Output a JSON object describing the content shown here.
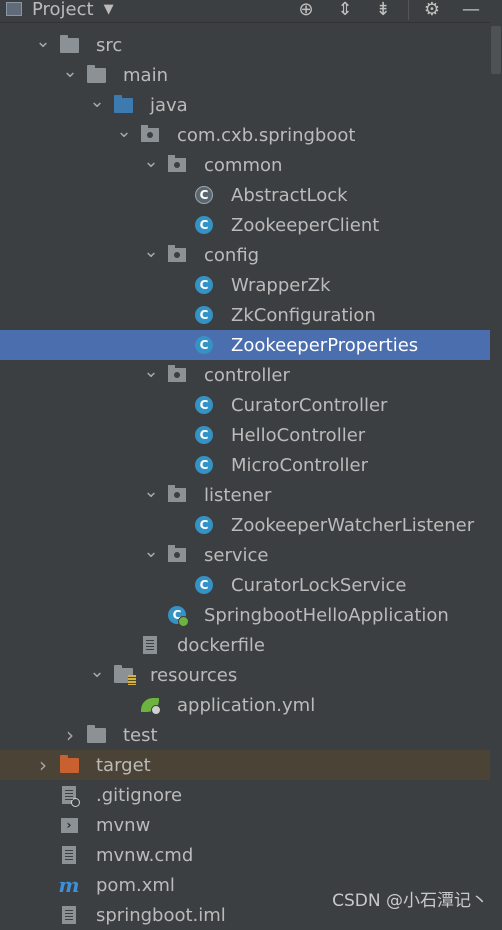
{
  "header": {
    "title": "Project",
    "icons": [
      "locate-icon",
      "expand-all-icon",
      "collapse-all-icon",
      "gear-icon",
      "minimize-icon"
    ]
  },
  "tree": [
    {
      "label": "src",
      "icon": "folder-icon",
      "arrow": "down"
    },
    {
      "label": "main",
      "icon": "folder-icon",
      "arrow": "down"
    },
    {
      "label": "java",
      "icon": "source-folder-icon",
      "arrow": "down"
    },
    {
      "label": "com.cxb.springboot",
      "icon": "package-icon",
      "arrow": "down"
    },
    {
      "label": "common",
      "icon": "package-icon",
      "arrow": "down"
    },
    {
      "label": "AbstractLock",
      "icon": "abstract-class-icon"
    },
    {
      "label": "ZookeeperClient",
      "icon": "class-icon"
    },
    {
      "label": "config",
      "icon": "package-icon",
      "arrow": "down"
    },
    {
      "label": "WrapperZk",
      "icon": "class-icon"
    },
    {
      "label": "ZkConfiguration",
      "icon": "class-icon"
    },
    {
      "label": "ZookeeperProperties",
      "icon": "class-icon",
      "selected": true
    },
    {
      "label": "controller",
      "icon": "package-icon",
      "arrow": "down"
    },
    {
      "label": "CuratorController",
      "icon": "class-icon"
    },
    {
      "label": "HelloController",
      "icon": "class-icon"
    },
    {
      "label": "MicroController",
      "icon": "class-icon"
    },
    {
      "label": "listener",
      "icon": "package-icon",
      "arrow": "down"
    },
    {
      "label": "ZookeeperWatcherListener",
      "icon": "class-icon"
    },
    {
      "label": "service",
      "icon": "package-icon",
      "arrow": "down"
    },
    {
      "label": "CuratorLockService",
      "icon": "class-icon"
    },
    {
      "label": "SpringbootHelloApplication",
      "icon": "spring-boot-class-icon"
    },
    {
      "label": "dockerfile",
      "icon": "text-file-icon"
    },
    {
      "label": "resources",
      "icon": "resources-folder-icon",
      "arrow": "down"
    },
    {
      "label": "application.yml",
      "icon": "spring-config-icon"
    },
    {
      "label": "test",
      "icon": "folder-icon",
      "arrow": "right"
    },
    {
      "label": "target",
      "icon": "excluded-folder-icon",
      "arrow": "right",
      "excluded": true
    },
    {
      "label": ".gitignore",
      "icon": "ignore-file-icon"
    },
    {
      "label": "mvnw",
      "icon": "shell-script-icon"
    },
    {
      "label": "mvnw.cmd",
      "icon": "text-file-icon"
    },
    {
      "label": "pom.xml",
      "icon": "maven-icon"
    },
    {
      "label": "springboot.iml",
      "icon": "module-file-icon"
    }
  ],
  "watermark": "CSDN @小石潭记丶"
}
